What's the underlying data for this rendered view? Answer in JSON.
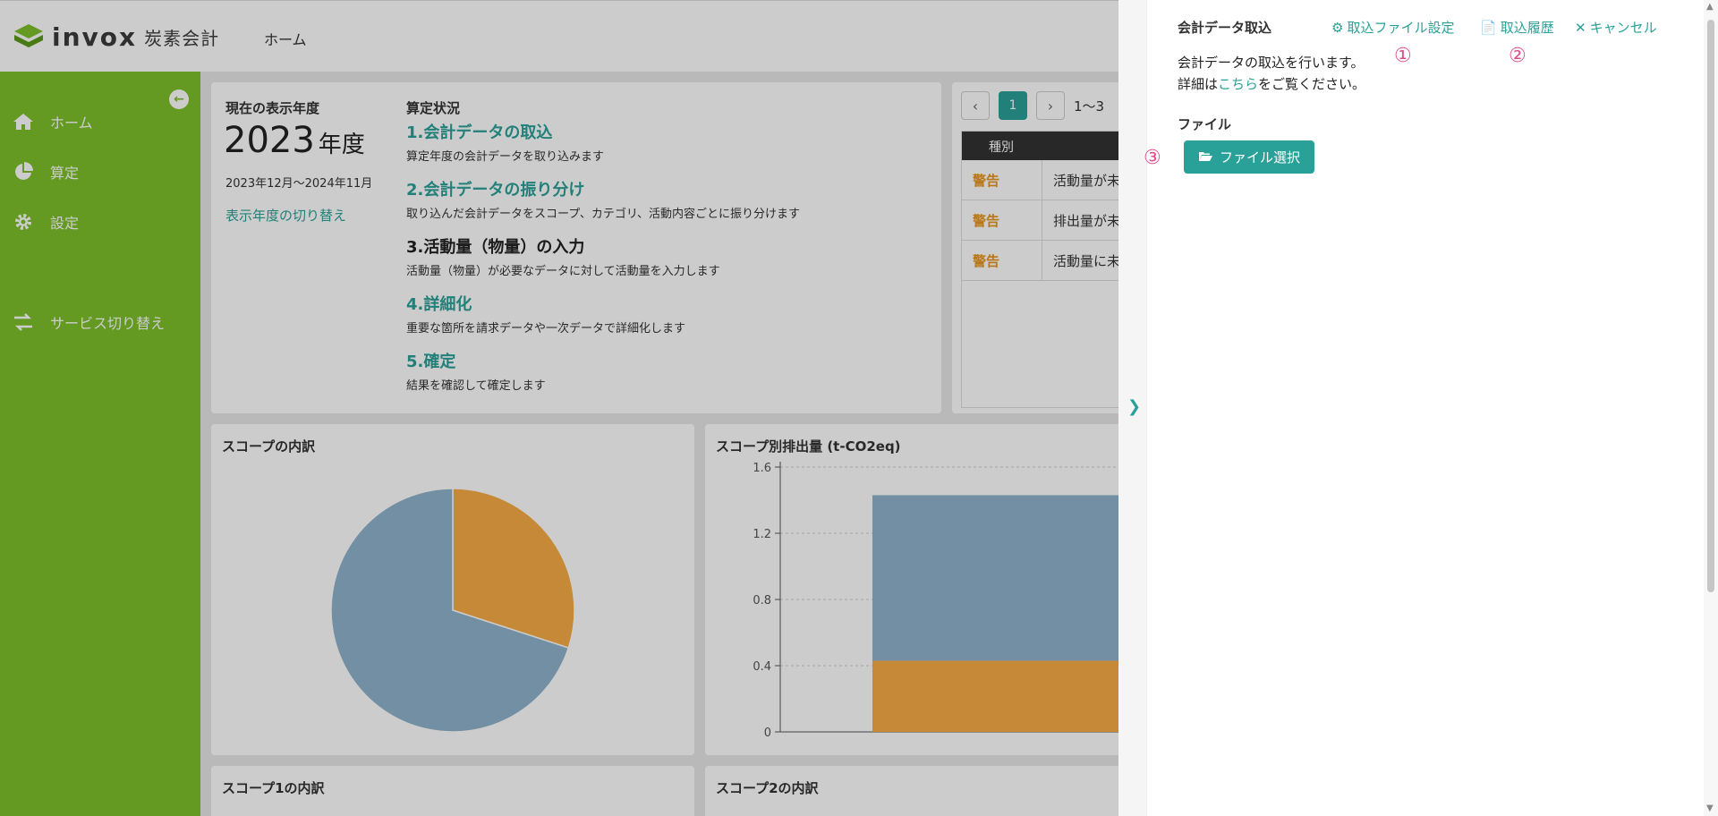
{
  "header": {
    "logo_brand": "invox",
    "logo_sub": "炭素会計",
    "home_link": "ホーム"
  },
  "sidebar": {
    "collapse_icon": "arrow-left-circle-icon",
    "items": [
      {
        "label": "ホーム",
        "icon": "home-icon"
      },
      {
        "label": "算定",
        "icon": "pie-icon"
      },
      {
        "label": "設定",
        "icon": "gear-icon"
      },
      {
        "label": "サービス切り替え",
        "icon": "switch-icon"
      }
    ]
  },
  "year_card": {
    "label": "現在の表示年度",
    "year": "2023",
    "year_unit": "年度",
    "range": "2023年12月〜2024年11月",
    "switch_link": "表示年度の切り替え"
  },
  "status_card": {
    "title": "算定状況",
    "steps": [
      {
        "title": "1.会計データの取込",
        "desc": "算定年度の会計データを取り込みます"
      },
      {
        "title": "2.会計データの振り分け",
        "desc": "取り込んだ会計データをスコープ、カテゴリ、活動内容ごとに振り分けます"
      },
      {
        "title": "3.活動量（物量）の入力",
        "desc": "活動量（物量）が必要なデータに対して活動量を入力します"
      },
      {
        "title": "4.詳細化",
        "desc": "重要な箇所を請求データや一次データで詳細化します"
      },
      {
        "title": "5.確定",
        "desc": "結果を確認して確定します"
      }
    ]
  },
  "warnings_card": {
    "prev": "‹",
    "page": "1",
    "next": "›",
    "info": "1〜3",
    "header": "種別",
    "rows": [
      {
        "kind": "警告",
        "text": "活動量が未"
      },
      {
        "kind": "警告",
        "text": "排出量が未"
      },
      {
        "kind": "警告",
        "text": "活動量に未"
      }
    ]
  },
  "scope_breakdown": {
    "title": "スコープの内訳"
  },
  "scope_emissions": {
    "title": "スコープ別排出量 (t-CO2eq)"
  },
  "scope1_card": {
    "title": "スコープ1の内訳"
  },
  "scope2_card": {
    "title": "スコープ2の内訳"
  },
  "drawer": {
    "title": "会計データ取込",
    "settings_link": "取込ファイル設定",
    "history_link": "取込履歴",
    "cancel_link": "キャンセル",
    "desc_line1": "会計データの取込を行います。",
    "desc_line2_pre": "詳細は",
    "desc_line2_link": "こちら",
    "desc_line2_post": "をご覧ください。",
    "file_label": "ファイル",
    "file_button": "ファイル選択",
    "markers": [
      "①",
      "②",
      "③"
    ]
  },
  "colors": {
    "accent": "#2aa198",
    "sidebar": "#7dc02b",
    "warning": "#e8951d",
    "series_blue": "#8fb3cc",
    "series_orange": "#f7ac45"
  },
  "chart_data": [
    {
      "type": "pie",
      "title": "スコープの内訳",
      "values": [
        70,
        30
      ],
      "colors": [
        "#8fb3cc",
        "#f7ac45"
      ]
    },
    {
      "type": "bar",
      "title": "スコープ別排出量 (t-CO2eq)",
      "stacked": true,
      "ylim": [
        0,
        1.6
      ],
      "yticks": [
        "0",
        "0.4",
        "0.8",
        "1.2",
        "1.6"
      ],
      "categories": [
        ""
      ],
      "series": [
        {
          "values": [
            0.43
          ],
          "color": "#f7ac45"
        },
        {
          "values": [
            1.0
          ],
          "color": "#8fb3cc"
        }
      ],
      "grid": true
    }
  ]
}
